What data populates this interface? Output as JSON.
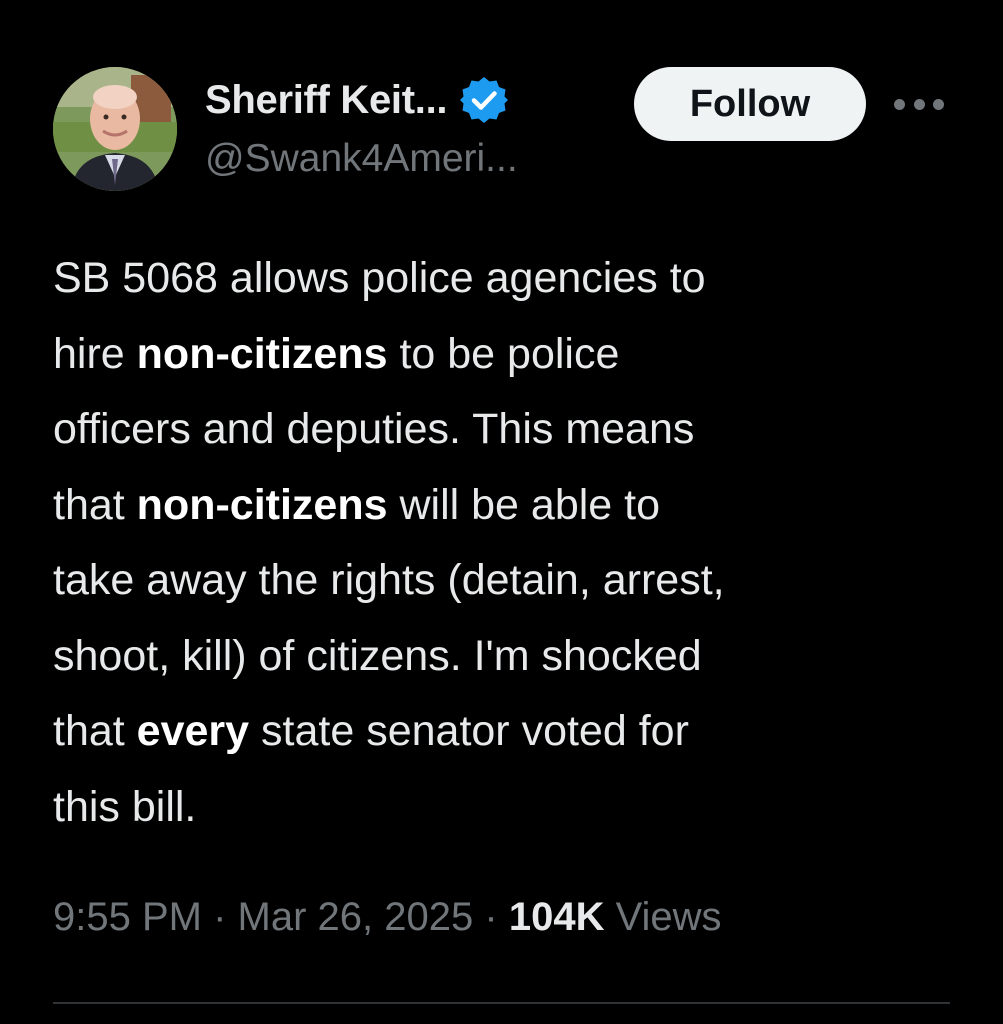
{
  "author": {
    "display_name": "Sheriff Keit...",
    "handle": "@Swank4Ameri...",
    "verified_icon": "verified-badge-icon",
    "avatar": "profile-photo"
  },
  "actions": {
    "follow_label": "Follow",
    "more_icon": "more-options-icon"
  },
  "tweet": {
    "lines": [
      [
        {
          "text": "SB 5068 allows police agencies to",
          "bold": false
        }
      ],
      [
        {
          "text": "hire ",
          "bold": false
        },
        {
          "text": "non-citizens",
          "bold": true
        },
        {
          "text": " to be police",
          "bold": false
        }
      ],
      [
        {
          "text": "officers and deputies. This means",
          "bold": false
        }
      ],
      [
        {
          "text": "that ",
          "bold": false
        },
        {
          "text": "non-citizens",
          "bold": true
        },
        {
          "text": " will be able to",
          "bold": false
        }
      ],
      [
        {
          "text": "take away the rights (detain, arrest,",
          "bold": false
        }
      ],
      [
        {
          "text": "shoot, kill) of citizens. I'm shocked",
          "bold": false
        }
      ],
      [
        {
          "text": "that ",
          "bold": false
        },
        {
          "text": "every",
          "bold": true
        },
        {
          "text": " state senator voted for",
          "bold": false
        }
      ],
      [
        {
          "text": "this bill.",
          "bold": false
        }
      ]
    ]
  },
  "meta": {
    "time": "9:55 PM",
    "separator": "·",
    "date": "Mar 26, 2025",
    "views_count": "104K",
    "views_label": "Views"
  },
  "colors": {
    "background": "#000000",
    "primary_text": "#e7e9ea",
    "secondary_text": "#71767b",
    "verified_blue": "#1d9bf0",
    "follow_bg": "#eff3f4",
    "divider": "#2f3336"
  }
}
